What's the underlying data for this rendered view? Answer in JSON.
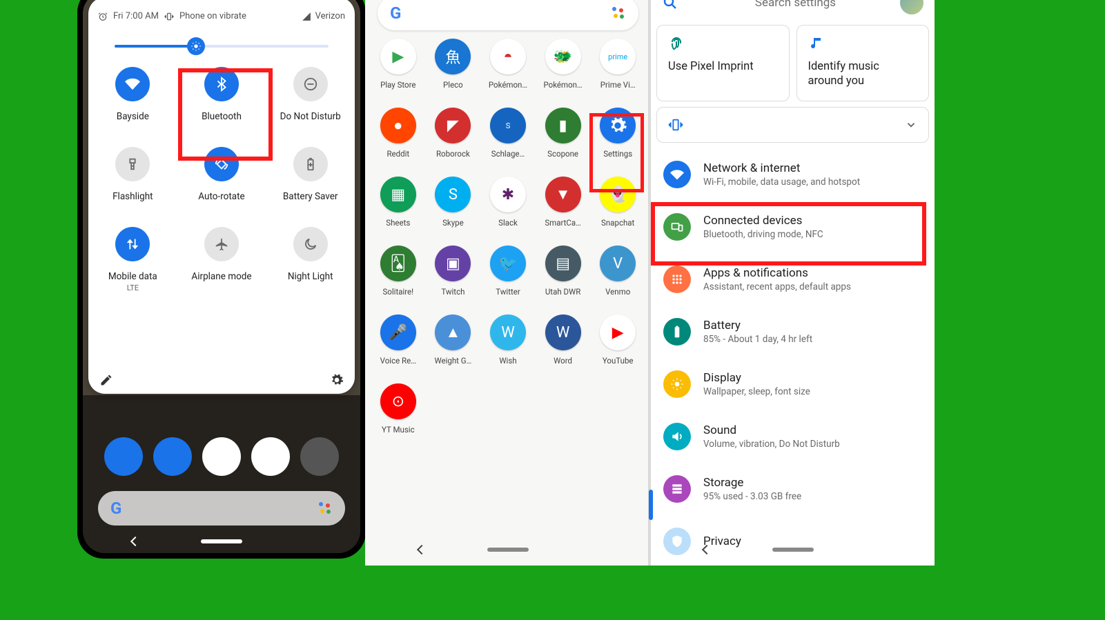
{
  "phone1": {
    "status": {
      "time": "Fri 7:00 AM",
      "silent": "Phone on vibrate",
      "carrier": "Verizon"
    },
    "tiles": [
      {
        "label": "Bayside",
        "sub": "",
        "state": "on",
        "icon": "wifi"
      },
      {
        "label": "Bluetooth",
        "sub": "",
        "state": "on",
        "icon": "bluetooth"
      },
      {
        "label": "Do Not Disturb",
        "sub": "",
        "state": "off",
        "icon": "minus"
      },
      {
        "label": "Flashlight",
        "sub": "",
        "state": "off",
        "icon": "flashlight"
      },
      {
        "label": "Auto-rotate",
        "sub": "",
        "state": "on",
        "icon": "rotate"
      },
      {
        "label": "Battery Saver",
        "sub": "",
        "state": "off",
        "icon": "battery"
      },
      {
        "label": "Mobile data",
        "sub": "LTE",
        "state": "on",
        "icon": "data"
      },
      {
        "label": "Airplane mode",
        "sub": "",
        "state": "off",
        "icon": "airplane"
      },
      {
        "label": "Night Light",
        "sub": "",
        "state": "off",
        "icon": "night"
      }
    ],
    "brightness_pct": 38
  },
  "phone2": {
    "apps": [
      {
        "name": "Play Store",
        "bg": "#ffffff",
        "glyph": "▶",
        "gcolor": "#34a853"
      },
      {
        "name": "Pleco",
        "bg": "#1976d2",
        "glyph": "魚"
      },
      {
        "name": "Pokémon…",
        "bg": "#ffffff",
        "glyph": "◓",
        "gcolor": "#d32f2f"
      },
      {
        "name": "Pokémon…",
        "bg": "#ffffff",
        "glyph": "🐲",
        "gcolor": "#000"
      },
      {
        "name": "Prime Vi…",
        "bg": "#ffffff",
        "glyph": "prime",
        "gcolor": "#00A8E1",
        "small": true
      },
      {
        "name": "Reddit",
        "bg": "#ff4500",
        "glyph": "●"
      },
      {
        "name": "Roborock",
        "bg": "#d32f2f",
        "glyph": "◤"
      },
      {
        "name": "Schlage…",
        "bg": "#1565c0",
        "glyph": "S",
        "small": true
      },
      {
        "name": "Scopone",
        "bg": "#2e7d32",
        "glyph": "▮"
      },
      {
        "name": "Settings",
        "bg": "#1a73e8",
        "glyph": "gear"
      },
      {
        "name": "Sheets",
        "bg": "#0f9d58",
        "glyph": "▦"
      },
      {
        "name": "Skype",
        "bg": "#00aff0",
        "glyph": "S"
      },
      {
        "name": "Slack",
        "bg": "#ffffff",
        "glyph": "✱",
        "gcolor": "#611f69"
      },
      {
        "name": "SmartCa…",
        "bg": "#d32f2f",
        "glyph": "▼"
      },
      {
        "name": "Snapchat",
        "bg": "#fffc00",
        "glyph": "👻",
        "gcolor": "#000"
      },
      {
        "name": "Solitaire!",
        "bg": "#2e7d32",
        "glyph": "🂡"
      },
      {
        "name": "Twitch",
        "bg": "#6441a5",
        "glyph": "▣"
      },
      {
        "name": "Twitter",
        "bg": "#1da1f2",
        "glyph": "🐦"
      },
      {
        "name": "Utah DWR",
        "bg": "#455a64",
        "glyph": "▤"
      },
      {
        "name": "Venmo",
        "bg": "#3d95ce",
        "glyph": "V"
      },
      {
        "name": "Voice Re…",
        "bg": "#1a73e8",
        "glyph": "🎤"
      },
      {
        "name": "Weight G…",
        "bg": "#4a90d9",
        "glyph": "▲"
      },
      {
        "name": "Wish",
        "bg": "#2fb7ec",
        "glyph": "W"
      },
      {
        "name": "Word",
        "bg": "#2b579a",
        "glyph": "W"
      },
      {
        "name": "YouTube",
        "bg": "#ffffff",
        "glyph": "▶",
        "gcolor": "#ff0000"
      },
      {
        "name": "YT Music",
        "bg": "#ff0000",
        "glyph": "⊙"
      }
    ]
  },
  "phone3": {
    "search_placeholder": "Search settings",
    "cards": [
      {
        "title": "Use Pixel Imprint",
        "icon": "fingerprint"
      },
      {
        "title": "Identify music around you",
        "icon": "music"
      }
    ],
    "items": [
      {
        "title": "Network & internet",
        "sub": "Wi-Fi, mobile, data usage, and hotspot",
        "bg": "#1a73e8",
        "icon": "wifi"
      },
      {
        "title": "Connected devices",
        "sub": "Bluetooth, driving mode, NFC",
        "bg": "#43a047",
        "icon": "devices"
      },
      {
        "title": "Apps & notifications",
        "sub": "Assistant, recent apps, default apps",
        "bg": "#ff7043",
        "icon": "apps"
      },
      {
        "title": "Battery",
        "sub": "85% - About 1 day, 4 hr left",
        "bg": "#00897b",
        "icon": "battery"
      },
      {
        "title": "Display",
        "sub": "Wallpaper, sleep, font size",
        "bg": "#fbbc04",
        "icon": "display"
      },
      {
        "title": "Sound",
        "sub": "Volume, vibration, Do Not Disturb",
        "bg": "#00acc1",
        "icon": "volume"
      },
      {
        "title": "Storage",
        "sub": "95% used - 3.03 GB free",
        "bg": "#ab47bc",
        "icon": "storage"
      },
      {
        "title": "Privacy",
        "sub": "",
        "bg": "#bbdefb",
        "icon": "privacy"
      }
    ]
  }
}
